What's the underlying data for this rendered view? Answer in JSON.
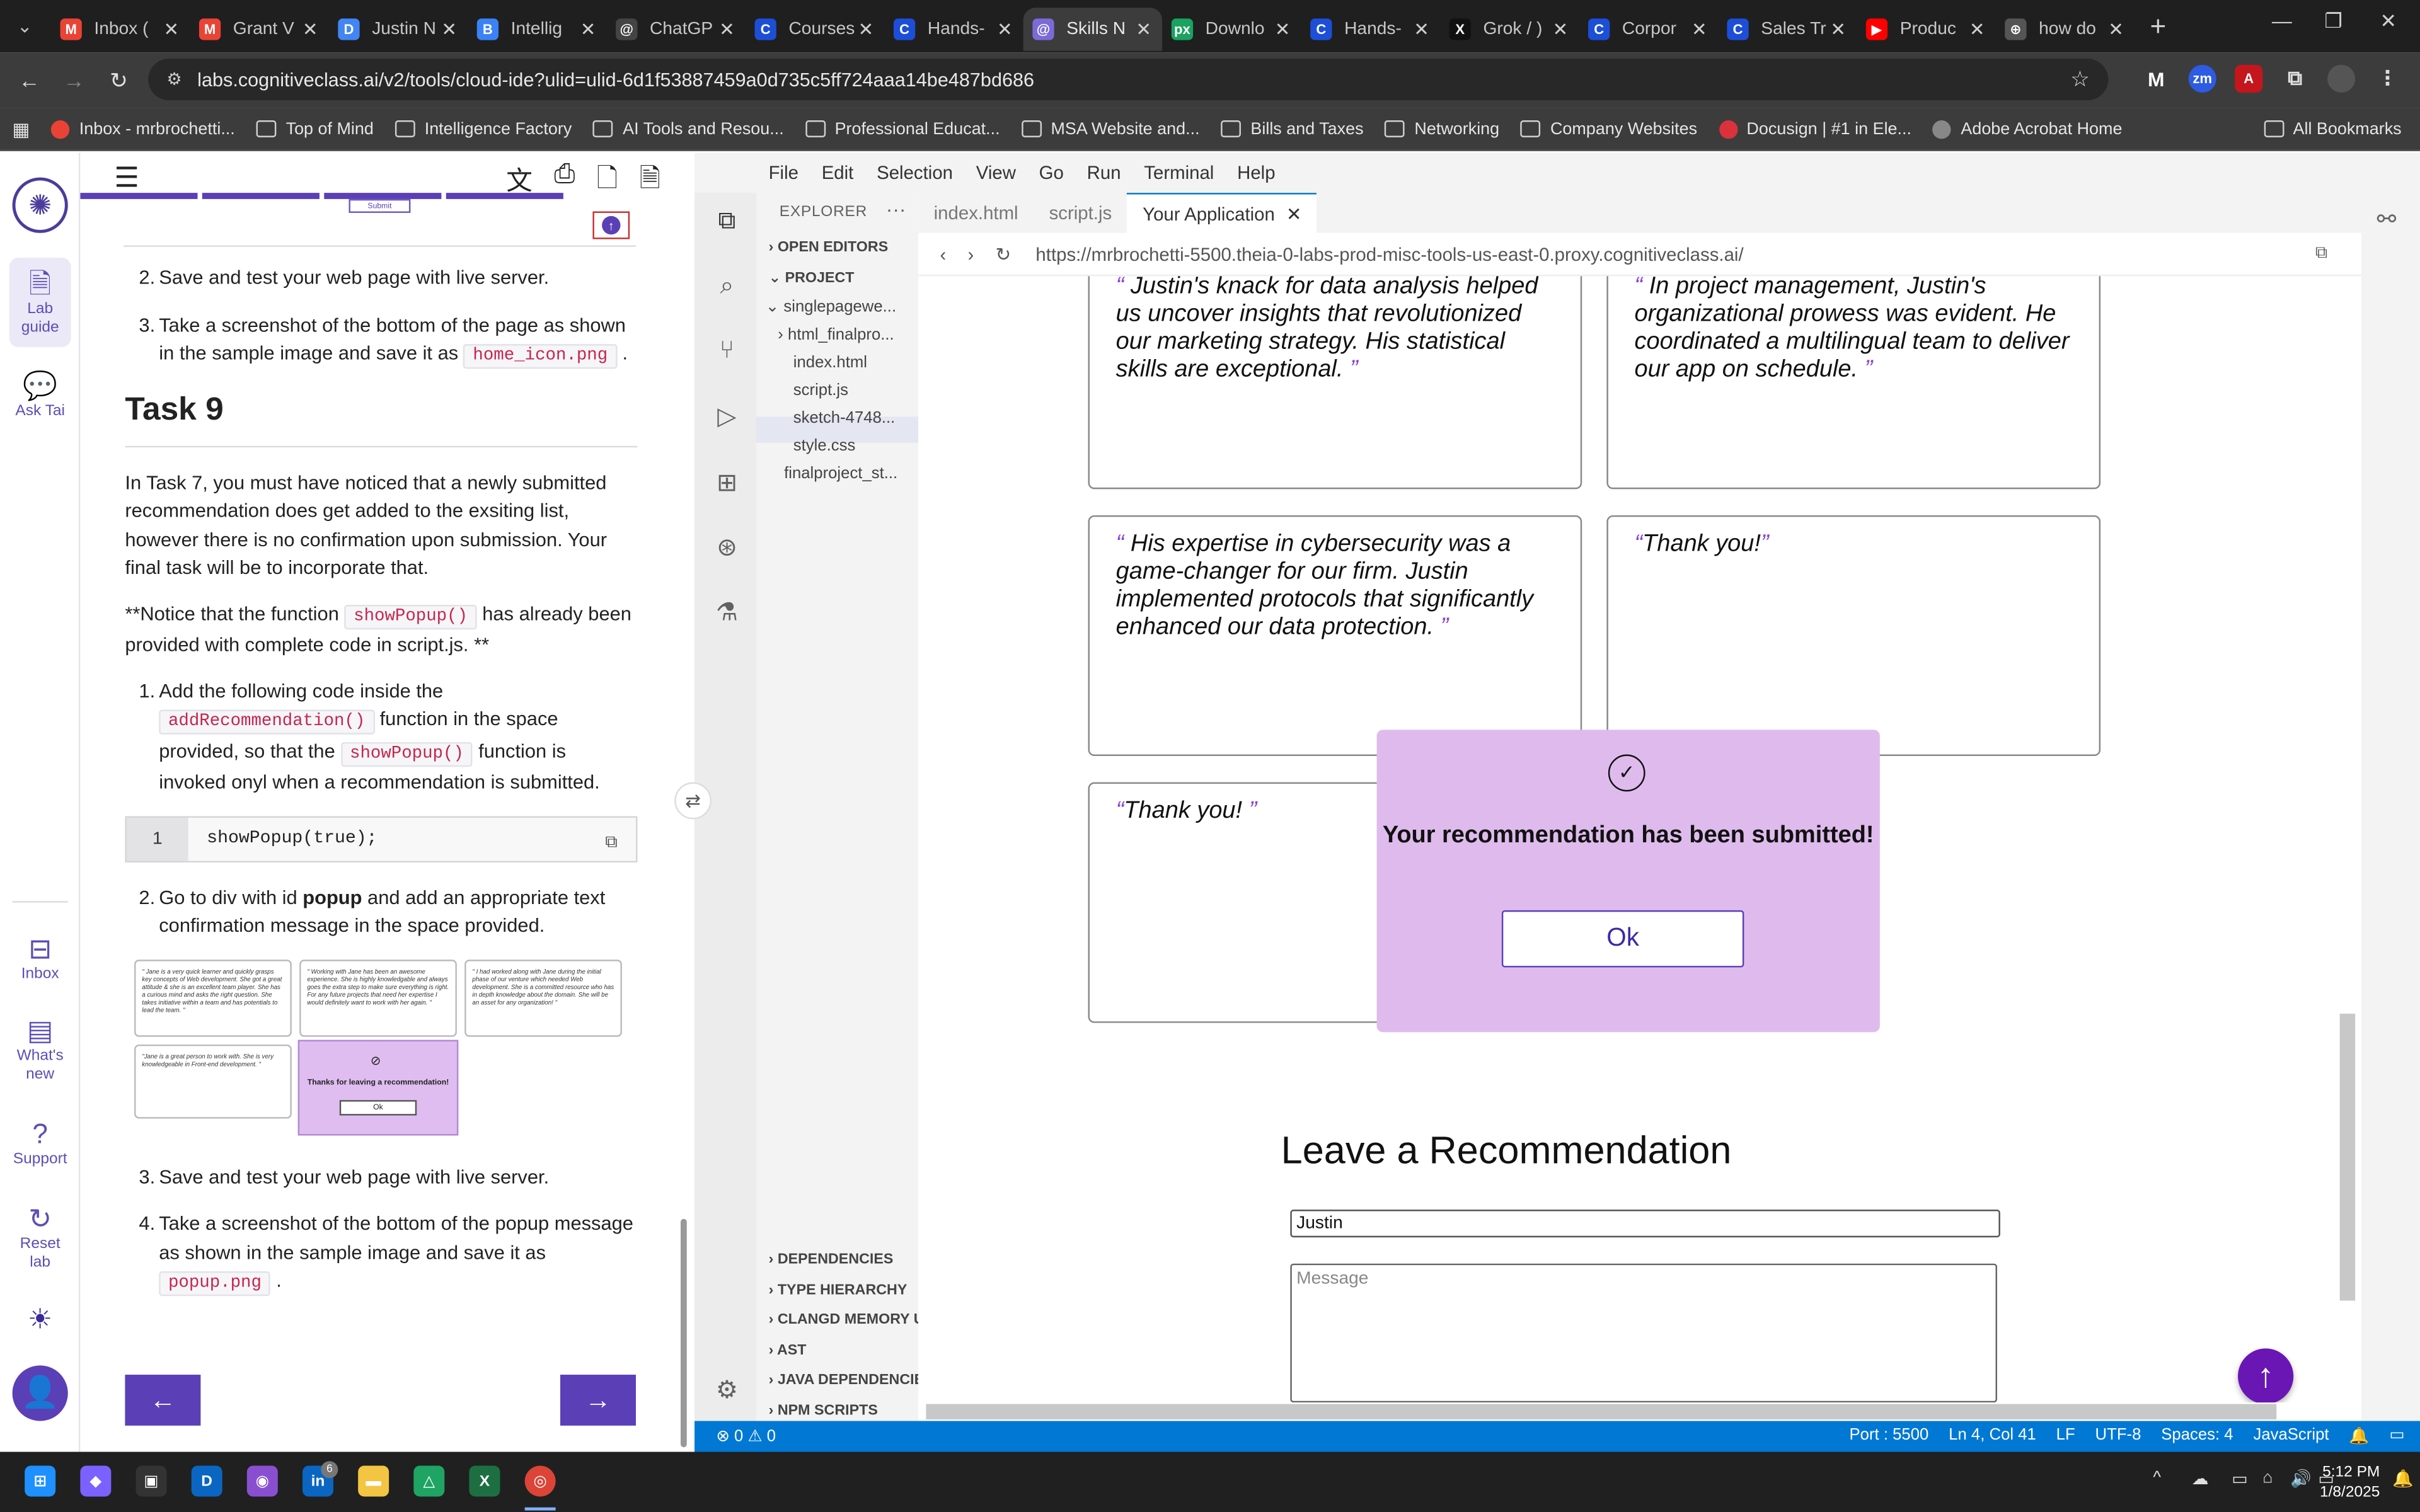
{
  "browser": {
    "tabs": [
      {
        "label": "Inbox (",
        "fav": "M",
        "color": "#ea4335"
      },
      {
        "label": "Grant V",
        "fav": "M",
        "color": "#ea4335"
      },
      {
        "label": "Justin N",
        "fav": "D",
        "color": "#4285f4"
      },
      {
        "label": "Intellig",
        "fav": "B",
        "color": "#3b82f6"
      },
      {
        "label": "ChatGP",
        "fav": "@",
        "color": "#444444"
      },
      {
        "label": "Courses",
        "fav": "C",
        "color": "#1d4ed8"
      },
      {
        "label": "Hands-",
        "fav": "C",
        "color": "#1d4ed8"
      },
      {
        "label": "Skills N",
        "fav": "@",
        "color": "#7c6ad8"
      },
      {
        "label": "Downlo",
        "fav": "px",
        "color": "#1aa260"
      },
      {
        "label": "Hands-",
        "fav": "C",
        "color": "#1d4ed8"
      },
      {
        "label": "Grok / )",
        "fav": "X",
        "color": "#111111"
      },
      {
        "label": "Corpor",
        "fav": "C",
        "color": "#1d4ed8"
      },
      {
        "label": "Sales Tr",
        "fav": "C",
        "color": "#1d4ed8"
      },
      {
        "label": "Produc",
        "fav": "▶",
        "color": "#ff0000"
      },
      {
        "label": "how do",
        "fav": "⊕",
        "color": "#555555"
      }
    ],
    "url": "labs.cognitiveclass.ai/v2/tools/cloud-ide?ulid=ulid-6d1f53887459a0d735c5ff724aaa14be487bd686",
    "bookmarks": [
      {
        "label": "Inbox - mrbrochetti...",
        "type": "fav",
        "color": "#ea4335"
      },
      {
        "label": "Top of Mind",
        "type": "folder"
      },
      {
        "label": "Intelligence Factory",
        "type": "folder"
      },
      {
        "label": "AI Tools and Resou...",
        "type": "folder"
      },
      {
        "label": "Professional Educat...",
        "type": "folder"
      },
      {
        "label": "MSA Website and...",
        "type": "folder"
      },
      {
        "label": "Bills and Taxes",
        "type": "folder"
      },
      {
        "label": "Networking",
        "type": "folder"
      },
      {
        "label": "Company Websites",
        "type": "folder"
      },
      {
        "label": "Docusign | #1 in Ele...",
        "type": "fav",
        "color": "#d9323b"
      },
      {
        "label": "Adobe Acrobat Home",
        "type": "fav",
        "color": "#888888"
      }
    ],
    "all_bookmarks": "All Bookmarks"
  },
  "rail": {
    "lab_guide": "Lab guide",
    "ask_tai": "Ask Tai",
    "inbox": "Inbox",
    "whats_new": "What's new",
    "support": "Support",
    "reset_lab": "Reset lab"
  },
  "guide": {
    "sample_submit": "Submit",
    "step2_top": "Save and test your web page with live server.",
    "step3_top_a": "Take a screenshot of the bottom of the page as shown in the sample image and save it as",
    "step3_top_code": "home_icon.png",
    "task_title": "Task 9",
    "intro": "In Task 7, you must have noticed that a newly submitted recommendation does get added to the exsiting list, however there is no confirmation upon submission. Your final task will be to incorporate that.",
    "notice_a": "**Notice that the function",
    "notice_code": "showPopup()",
    "notice_b": "has already been provided with complete code in script.js. **",
    "s1_a": "Add the following code inside the",
    "s1_code1": "addRecommendation()",
    "s1_b": "function in the space provided, so that the",
    "s1_code2": "showPopup()",
    "s1_c": "function is invoked onyl when a recommendation is submitted.",
    "code_line_no": "1",
    "code_line": "showPopup(true);",
    "s2_a": "Go to div with id",
    "s2_bold": "popup",
    "s2_b": "and add an appropriate text confirmation message in the space provided.",
    "sample_cards": [
      "\" Jane is a very quick learner and quickly grasps key concepts of Web development. She got a great attitude & she is an excellent team player. She has a curious mind and asks the right question. She takes initiative within a team and has potentials to lead the team. \"",
      "\" Working with Jane has been an awesome experience. She is highly knowledgable and always goes the extra step to make sure everything is right. For any future projects that need her expertise I would definitely want to work with her again. \"",
      "\" I had worked along with Jane during the initial phase of our venture which needed Web development. She is a committed resource who has in depth knowledge about the domain. She will be an asset for any organization! \"",
      "\"Jane is a great person to work with. She is very knowledgeable in Front-end development. \""
    ],
    "sample_popup_text": "Thanks for leaving a recommendation!",
    "sample_popup_ok": "Ok",
    "s3": "Save and test your web page with live server.",
    "s4_a": "Take a screenshot of the bottom of the popup message as shown in the sample image and save it as",
    "s4_code": "popup.png",
    "num2": "2.",
    "num3": "3.",
    "n1": "1.",
    "n2": "2.",
    "n3": "3.",
    "n4": "4."
  },
  "ide": {
    "menu": [
      "File",
      "Edit",
      "Selection",
      "View",
      "Go",
      "Run",
      "Terminal",
      "Help"
    ],
    "explorer_title": "EXPLORER",
    "open_editors": "OPEN EDITORS",
    "project": "PROJECT",
    "tree": [
      "singlepagewe...",
      "html_finalpro...",
      "index.html",
      "script.js",
      "sketch-4748...",
      "style.css",
      "finalproject_st..."
    ],
    "bottom_sections": [
      "DEPENDENCIES",
      "TYPE HIERARCHY",
      "CLANGD MEMORY U",
      "AST",
      "JAVA DEPENDENCIE",
      "NPM SCRIPTS"
    ],
    "tabs": [
      "index.html",
      "script.js",
      "Your Application"
    ],
    "preview_url": "https://mrbrochetti-5500.theia-0-labs-prod-misc-tools-us-east-0.proxy.cognitiveclass.ai/",
    "cards": [
      "Justin's knack for data analysis helped us uncover insights that revolutionized our marketing strategy. His statistical skills are exceptional.",
      "In project management, Justin's organizational prowess was evident. He coordinated a multilingual team to deliver our app on schedule.",
      "His expertise in cybersecurity was a game-changer for our firm. Justin implemented protocols that significantly enhanced our data protection.",
      "Thank you!",
      "Thank you!"
    ],
    "popup_text": "Your recommendation has been submitted!",
    "popup_ok": "Ok",
    "leave_heading": "Leave a Recommendation",
    "name_value": "Justin",
    "message_placeholder": "Message",
    "status": {
      "problems": "0",
      "warnings": "0",
      "port": "Port : 5500",
      "position": "Ln 4, Col 41",
      "eol": "LF",
      "encoding": "UTF-8",
      "spaces": "Spaces: 4",
      "language": "JavaScript"
    }
  },
  "taskbar": {
    "time": "5:12 PM",
    "date": "1/8/2025",
    "badge": "6"
  },
  "colors": {
    "accent": "#5b3fb7",
    "popup_bg": "#dfbbed",
    "status_bar": "#0078d4",
    "fab": "#6a16b5"
  }
}
